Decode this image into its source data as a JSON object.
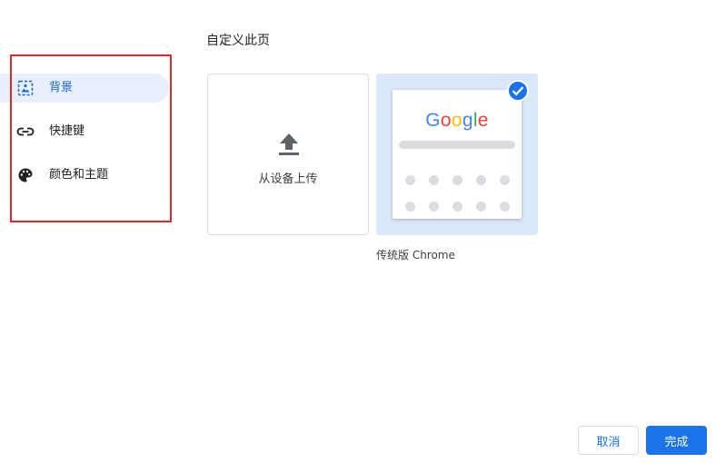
{
  "page": {
    "title": "自定义此页"
  },
  "sidebar": {
    "items": [
      {
        "label": "背景",
        "icon": "background-image-icon",
        "selected": true
      },
      {
        "label": "快捷键",
        "icon": "link-icon",
        "selected": false
      },
      {
        "label": "颜色和主题",
        "icon": "palette-icon",
        "selected": false
      }
    ]
  },
  "tiles": {
    "upload": {
      "label": "从设备上传",
      "icon": "upload-icon"
    },
    "classic": {
      "label": "传统版 Chrome",
      "logo_text": "Google",
      "selected": true,
      "selected_icon": "check-icon"
    }
  },
  "footer": {
    "cancel_label": "取消",
    "done_label": "完成"
  },
  "colors": {
    "accent": "#1a73e8",
    "selected_bg": "#e8f0fe",
    "tile_selected_bg": "#dbe7fb",
    "highlight_border": "#e02828",
    "google_blue": "#4285f4",
    "google_red": "#ea4335",
    "google_yellow": "#fbbc05",
    "google_green": "#34a853"
  }
}
